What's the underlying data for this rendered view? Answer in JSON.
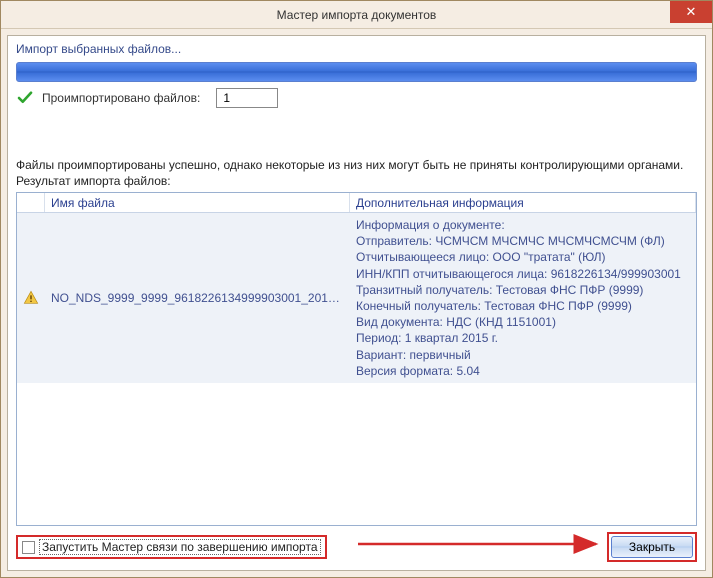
{
  "window": {
    "title": "Мастер импорта документов"
  },
  "import": {
    "label": "Импорт выбранных файлов...",
    "status_text": "Проимпортировано файлов:",
    "count": "1"
  },
  "warning": "Файлы проимпортированы успешно, однако некоторые из низ них могут быть не приняты контролирующими органами.",
  "result_label": "Результат импорта файлов:",
  "table": {
    "columns": {
      "name": "Имя файла",
      "info": "Дополнительная информация"
    },
    "rows": [
      {
        "filename": "NO_NDS_9999_9999_9618226134999903001_2015...",
        "info": "Информация о документе:\nОтправитель: ЧСМЧСМ МЧСМЧС МЧСМЧСМСЧМ (ФЛ)\nОтчитывающееся лицо: ООО \"тратата\" (ЮЛ)\nИНН/КПП отчитывающегося лица: 9618226134/999903001\nТранзитный получатель: Тестовая ФНС ПФР (9999)\nКонечный получатель: Тестовая ФНС ПФР (9999)\nВид документа: НДС (КНД 1151001)\nПериод: 1 квартал 2015 г.\nВариант: первичный\nВерсия формата: 5.04"
      }
    ]
  },
  "footer": {
    "checkbox_label": "Запустить Мастер связи по завершению импорта",
    "close_button": "Закрыть"
  }
}
